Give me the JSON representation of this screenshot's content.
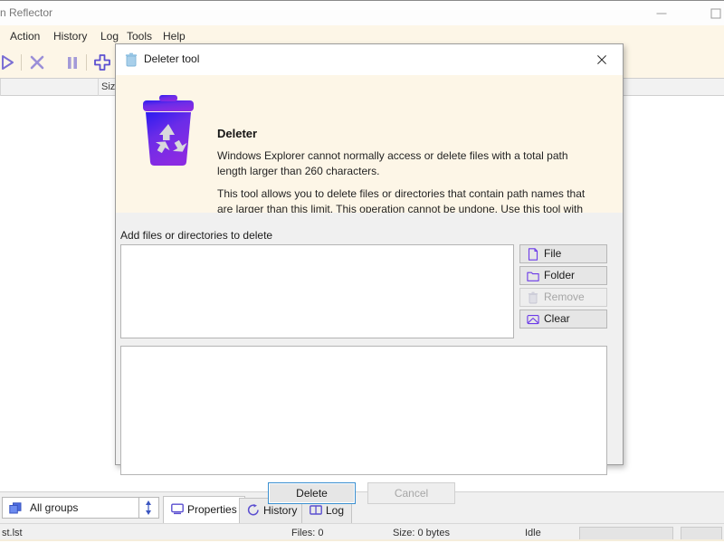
{
  "app": {
    "titlebar": {
      "title": "n Reflector",
      "minimize_label": "Minimize",
      "maximize_label": "Maximize"
    },
    "menubar": {
      "items": [
        {
          "label": "Action"
        },
        {
          "label": "History"
        },
        {
          "label": "Log"
        },
        {
          "label": "Tools"
        },
        {
          "label": "Help"
        }
      ]
    },
    "toolbar": {
      "buttons": [
        {
          "name": "run-icon",
          "label": "Run"
        },
        {
          "name": "stop-icon",
          "label": "Stop"
        },
        {
          "name": "pause-icon",
          "label": "Pause"
        },
        {
          "name": "add-icon",
          "label": "Add"
        }
      ]
    },
    "columns": {
      "size_header": "Siz"
    },
    "group_selector": {
      "value": "All groups",
      "icon": "groups-icon"
    },
    "tabs": [
      {
        "label": "Properties",
        "icon": "monitor-icon",
        "active": true
      },
      {
        "label": "History",
        "icon": "history-icon",
        "active": false
      },
      {
        "label": "Log",
        "icon": "book-icon",
        "active": false
      }
    ],
    "statusbar": {
      "file": "st.lst",
      "files": "Files: 0",
      "size": "Size: 0 bytes",
      "state": "Idle"
    }
  },
  "dialog": {
    "title": "Deleter tool",
    "title_icon": "trash-icon",
    "close_label": "Close",
    "banner": {
      "heading": "Deleter",
      "icon": "recycle-bin-icon",
      "paragraph1": "Windows Explorer cannot normally access or delete files with a total path length larger than 260 characters.",
      "paragraph2": "This tool allows you to delete files or directories that contain path names that are larger than this limit. This operation cannot be undone. Use this tool with care!"
    },
    "body": {
      "add_label": "Add files or directories to delete",
      "files_list_value": "",
      "output_list_value": "",
      "side_buttons": [
        {
          "label": "File",
          "icon": "file-icon",
          "disabled": false
        },
        {
          "label": "Folder",
          "icon": "folder-icon",
          "disabled": false
        },
        {
          "label": "Remove",
          "icon": "trash-icon",
          "disabled": true
        },
        {
          "label": "Clear",
          "icon": "inbox-icon",
          "disabled": true
        }
      ]
    },
    "footer": {
      "delete_label": "Delete",
      "cancel_label": "Cancel"
    }
  },
  "colors": {
    "banner_bg": "#FDF6E7",
    "accent_purple": "#6C3BE8",
    "accent_blue": "#3A8FD0",
    "toolbar_purple": "#7B6FD4",
    "tab_icon_purple": "#5B4FD0",
    "dialog_bg": "#F0F0F0"
  }
}
